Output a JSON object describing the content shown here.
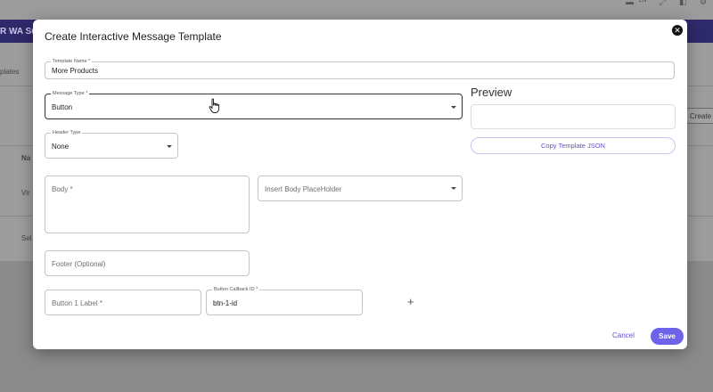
{
  "background": {
    "app_title": "R WA Su",
    "lang": "EN",
    "tab_partial": "plates",
    "table_header_partial": "Na",
    "row1_partial": "Vir",
    "row2_partial": "Sel",
    "create_button_partial": "Create I"
  },
  "modal": {
    "title": "Create Interactive Message Template",
    "close_symbol": "✕",
    "template_name": {
      "label": "Template Name *",
      "value": "More Products"
    },
    "message_type": {
      "label": "Message Type *",
      "value": "Button"
    },
    "header_type": {
      "label": "Header Type",
      "value": "None"
    },
    "body": {
      "placeholder": "Body *"
    },
    "insert_placeholder": {
      "placeholder": "Insert Body PlaceHolder"
    },
    "footer": {
      "placeholder": "Footer (Optional)"
    },
    "button1_label": {
      "placeholder": "Button 1 Label *"
    },
    "button_callback": {
      "label": "Button Callback ID *",
      "value": "btn-1-id"
    },
    "add_symbol": "+",
    "preview_title": "Preview",
    "copy_button": "Copy Template JSON",
    "cancel": "Cancel",
    "save": "Save"
  },
  "colors": {
    "accent": "#6c63e8",
    "accent_text": "#5c54d0",
    "header_bar": "#2f2a6b"
  }
}
